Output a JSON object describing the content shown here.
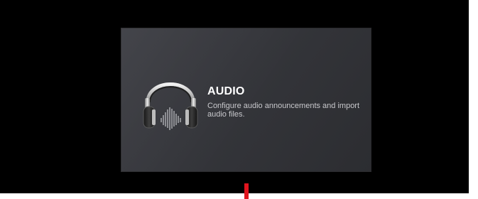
{
  "card": {
    "title": "AUDIO",
    "description": "Configure audio announcements and import audio files.",
    "icon": "headphones-icon"
  },
  "colors": {
    "background": "#000000",
    "card": "#36373c",
    "title": "#ffffff",
    "description": "#c8c8cc",
    "marker": "#e0141e"
  }
}
